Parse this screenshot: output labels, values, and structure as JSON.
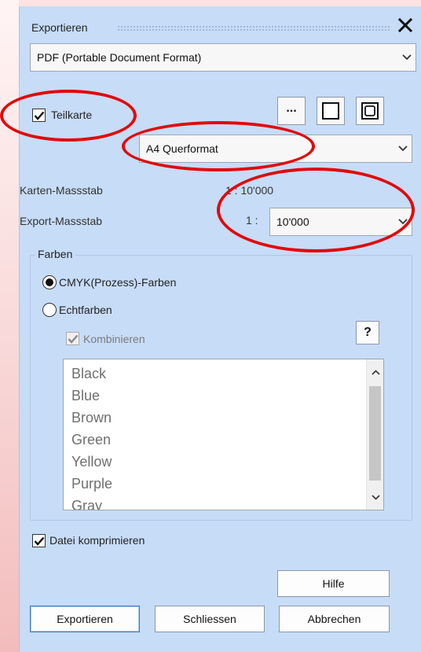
{
  "window": {
    "title": "Exportieren",
    "close_glyph": "✕"
  },
  "format": {
    "selected": "PDF (Portable Document Format)"
  },
  "partial_map": {
    "label": "Teilkarte",
    "checked": true,
    "ellipsis_label": "..."
  },
  "paper": {
    "selected": "A4 Querformat"
  },
  "scale": {
    "map_scale_label": "Karten-Massstab",
    "map_scale_value": "1 : 10'000",
    "export_scale_label": "Export-Massstab",
    "export_scale_prefix": "1 :",
    "export_scale_value": "10'000"
  },
  "colors_group": {
    "title": "Farben",
    "options": [
      {
        "label": "CMYK(Prozess)-Farben",
        "selected": true
      },
      {
        "label": "Echtfarben",
        "selected": false
      }
    ],
    "combine_label": "Kombinieren",
    "combine_checked": true,
    "help_label": "?",
    "list": [
      "Black",
      "Blue",
      "Brown",
      "Green",
      "Yellow",
      "Purple",
      "Gray"
    ]
  },
  "compress": {
    "label": "Datei komprimieren",
    "checked": true
  },
  "buttons": {
    "help": "Hilfe",
    "export": "Exportieren",
    "close": "Schliessen",
    "cancel": "Abbrechen"
  },
  "colors": {
    "panel_bg": "#c7dcf7",
    "annotation": "#e10a0a"
  }
}
